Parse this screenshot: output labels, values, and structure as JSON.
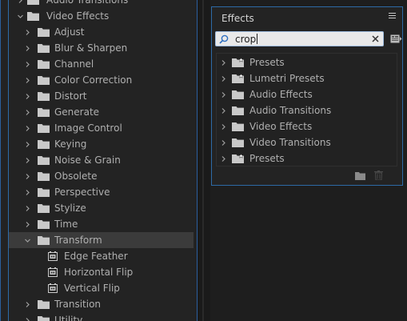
{
  "colors": {
    "accent_border": "#2d6aa6",
    "panel_bg": "#232323",
    "selected_row_bg": "#3b3b3b",
    "text": "#b0b0b0",
    "search_bg": "#e9e9e9"
  },
  "left_tree": {
    "items": [
      {
        "label": "Audio Transitions",
        "icon": "folder-icon",
        "state": "collapsed",
        "level": 0
      },
      {
        "label": "Video Effects",
        "icon": "folder-icon",
        "state": "expanded",
        "level": 0
      },
      {
        "label": "Adjust",
        "icon": "folder-icon",
        "state": "collapsed",
        "level": 1
      },
      {
        "label": "Blur & Sharpen",
        "icon": "folder-icon",
        "state": "collapsed",
        "level": 1
      },
      {
        "label": "Channel",
        "icon": "folder-icon",
        "state": "collapsed",
        "level": 1
      },
      {
        "label": "Color Correction",
        "icon": "folder-icon",
        "state": "collapsed",
        "level": 1
      },
      {
        "label": "Distort",
        "icon": "folder-icon",
        "state": "collapsed",
        "level": 1
      },
      {
        "label": "Generate",
        "icon": "folder-icon",
        "state": "collapsed",
        "level": 1
      },
      {
        "label": "Image Control",
        "icon": "folder-icon",
        "state": "collapsed",
        "level": 1
      },
      {
        "label": "Keying",
        "icon": "folder-icon",
        "state": "collapsed",
        "level": 1
      },
      {
        "label": "Noise & Grain",
        "icon": "folder-icon",
        "state": "collapsed",
        "level": 1
      },
      {
        "label": "Obsolete",
        "icon": "folder-icon",
        "state": "collapsed",
        "level": 1
      },
      {
        "label": "Perspective",
        "icon": "folder-icon",
        "state": "collapsed",
        "level": 1
      },
      {
        "label": "Stylize",
        "icon": "folder-icon",
        "state": "collapsed",
        "level": 1
      },
      {
        "label": "Time",
        "icon": "folder-icon",
        "state": "collapsed",
        "level": 1
      },
      {
        "label": "Transform",
        "icon": "folder-icon",
        "state": "expanded",
        "level": 1,
        "selected": true
      },
      {
        "label": "Edge Feather",
        "icon": "effect-icon",
        "level": 2
      },
      {
        "label": "Horizontal Flip",
        "icon": "effect-icon",
        "level": 2
      },
      {
        "label": "Vertical Flip",
        "icon": "effect-icon",
        "level": 2
      },
      {
        "label": "Transition",
        "icon": "folder-icon",
        "state": "collapsed",
        "level": 1
      },
      {
        "label": "Utility",
        "icon": "folder-icon",
        "state": "collapsed",
        "level": 1
      }
    ]
  },
  "effects_panel": {
    "title": "Effects",
    "menu_icon": "hamburger-menu-icon",
    "search": {
      "value": "crop",
      "placeholder": "",
      "icon": "search-icon",
      "clear_icon": "close-icon"
    },
    "new_bin_icon": "new-custom-bin-icon",
    "items": [
      {
        "label": "Presets",
        "icon": "preset-folder-icon"
      },
      {
        "label": "Lumetri Presets",
        "icon": "preset-folder-icon"
      },
      {
        "label": "Audio Effects",
        "icon": "folder-icon"
      },
      {
        "label": "Audio Transitions",
        "icon": "folder-icon"
      },
      {
        "label": "Video Effects",
        "icon": "folder-icon"
      },
      {
        "label": "Video Transitions",
        "icon": "folder-icon"
      },
      {
        "label": "Presets",
        "icon": "preset-folder-icon"
      }
    ],
    "footer": {
      "new_folder_icon": "new-folder-icon",
      "delete_icon": "trash-icon"
    }
  }
}
